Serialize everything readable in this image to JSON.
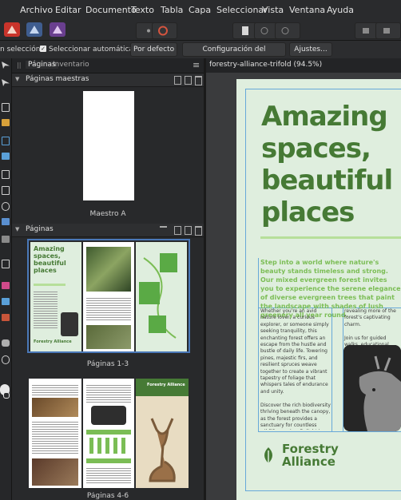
{
  "menu": [
    "Archivo",
    "Editar",
    "Documento",
    "Texto",
    "Tabla",
    "Capa",
    "Seleccionar",
    "Vista",
    "Ventana",
    "Ayuda"
  ],
  "context_bar": {
    "selection_label": "n selección",
    "auto_select_label": "Seleccionar automáticamente:",
    "auto_select_value": "Por defecto",
    "doc_setup_button": "Configuración del documento...",
    "settings_button": "Ajustes..."
  },
  "panel": {
    "tabs": [
      "Páginas",
      "Inventario"
    ],
    "masters_header": "Páginas maestras",
    "master_label": "Maestro A",
    "pages_header": "Páginas",
    "spread1_label": "Páginas 1-3",
    "spread2_label": "Páginas 4-6"
  },
  "document": {
    "tab_title": "forestry-alliance-trifold (94.5%)",
    "headline": "Amazing\nspaces,\nbeautiful\nplaces",
    "intro": "Step into a world where nature's beauty stands timeless and strong. Our mixed evergreen forest invites you to experience the serene elegance of diverse evergreen trees that paint the landscape with shades of lush greenery all year round.",
    "col1": "Whether you're an avid nature lover, a curious explorer, or someone simply seeking tranquility, this enchanting forest offers an escape from the hustle and bustle of daily life. Towering pines, majestic firs, and resilient spruces weave together to create a vibrant tapestry of foliage that whispers tales of endurance and unity.\n\nDiscover the rich biodiversity thriving beneath the canopy, as the forest provides a sanctuary for countless wildlife species. Delight in the symphony of chirping birds, rustling leaves, and the gentle sway of branches as you wander through well-marked trails, each.",
    "col2": "revealing more of the forest's captivating charm.\n\nJoin us for guided walks, educational programs, and",
    "logo_line1": "Forestry",
    "logo_line2": "Alliance",
    "thumb_headline": "Amazing spaces, beautiful places",
    "thumb_logo": "Forestry Alliance"
  },
  "colors": {
    "brand_green": "#467a35",
    "light_green": "#7bbd55",
    "page_bg": "#dfeede"
  }
}
